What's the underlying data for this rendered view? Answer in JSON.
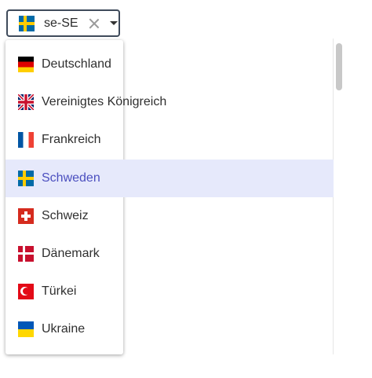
{
  "select": {
    "value": "se-SE",
    "flag_icon": "flag-sweden-icon"
  },
  "menu": {
    "items": [
      {
        "label": "Deutschland",
        "flag": "flag-germany-icon",
        "selected": false
      },
      {
        "label": "Vereinigtes Königreich",
        "flag": "flag-united-kingdom-icon",
        "selected": false
      },
      {
        "label": "Frankreich",
        "flag": "flag-france-icon",
        "selected": false
      },
      {
        "label": "Schweden",
        "flag": "flag-sweden-icon",
        "selected": true
      },
      {
        "label": "Schweiz",
        "flag": "flag-switzerland-icon",
        "selected": false
      },
      {
        "label": "Dänemark",
        "flag": "flag-denmark-icon",
        "selected": false
      },
      {
        "label": "Türkei",
        "flag": "flag-turkey-icon",
        "selected": false
      },
      {
        "label": "Ukraine",
        "flag": "flag-ukraine-icon",
        "selected": false
      }
    ]
  },
  "colors": {
    "selected_bg": "#e6e9fb",
    "selected_text": "#4b4fbf",
    "trigger_border": "#3f4b5b"
  }
}
